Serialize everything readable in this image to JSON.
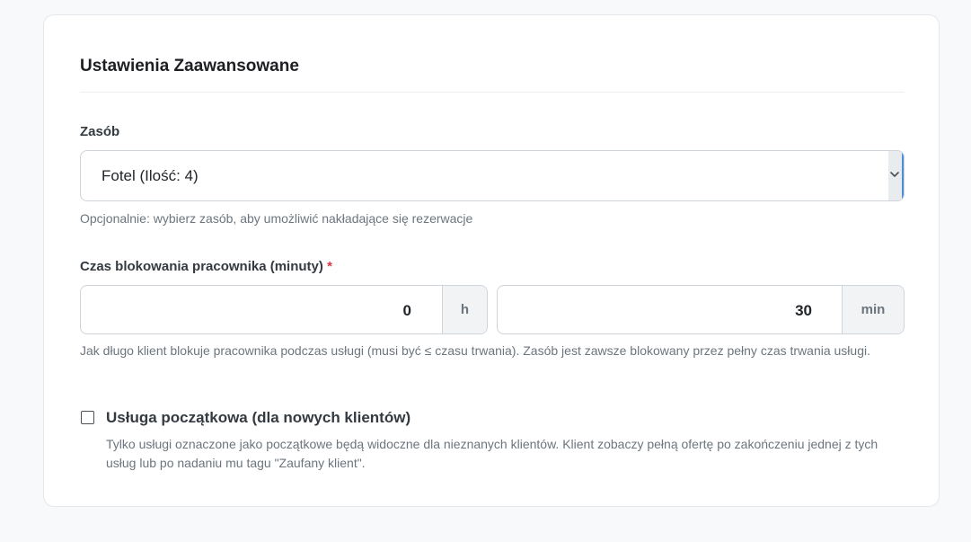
{
  "section": {
    "title": "Ustawienia Zaawansowane"
  },
  "resource": {
    "label": "Zasób",
    "selected_value": "Fotel (Ilość: 4)",
    "help": "Opcjonalnie: wybierz zasób, aby umożliwić nakładające się rezerwacje"
  },
  "block_time": {
    "label": "Czas blokowania pracownika (minuty)",
    "required_mark": "*",
    "hours_value": "0",
    "hours_unit": "h",
    "minutes_value": "30",
    "minutes_unit": "min",
    "help": "Jak długo klient blokuje pracownika podczas usługi (musi być ≤ czasu trwania). Zasób jest zawsze blokowany przez pełny czas trwania usługi."
  },
  "initial_service": {
    "checked": false,
    "label": "Usługa początkowa (dla nowych klientów)",
    "help": "Tylko usługi oznaczone jako początkowe będą widoczne dla nieznanych klientów. Klient zobaczy pełną ofertę po zakończeniu jednej z tych usług lub po nadaniu mu tagu \"Zaufany klient\"."
  },
  "colors": {
    "page_background": "#f8f9fb",
    "card_background": "#ffffff",
    "required": "#dc3545",
    "focus_accent": "#4a8fd8"
  },
  "icons": {
    "select_arrow": "chevron-down-icon"
  }
}
